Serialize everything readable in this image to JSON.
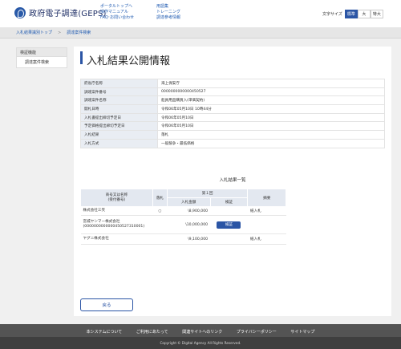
{
  "header": {
    "logo_text": "政府電子調達(GEPS)",
    "links_col1": [
      "ポータルトップへ",
      "操作マニュアル",
      "FAQ･お問い合わせ"
    ],
    "links_col2": [
      "用語集",
      "トレーニング",
      "調達参考情報"
    ],
    "font_size_label": "文字サイズ",
    "font_sizes": [
      "標準",
      "大",
      "特大"
    ],
    "font_size_selected": "標準"
  },
  "breadcrumb": {
    "items": [
      "入札結果識別トップ",
      "調達案件検索"
    ]
  },
  "sidebar": {
    "heading": "検証機能",
    "items": [
      "調達案件検索"
    ]
  },
  "main": {
    "title": "入札結果公開情報",
    "info_rows": [
      {
        "label": "府省庁名称",
        "value": "海上保安庁"
      },
      {
        "label": "調達案件番号",
        "value": "0000000000000450527"
      },
      {
        "label": "調達案件名称",
        "value": "船員用品購買入(単価契約)"
      },
      {
        "label": "開札日時",
        "value": "令和06年05月10日 10時44分"
      },
      {
        "label": "入札書提出締切予定日",
        "value": "令和06年05月10日"
      },
      {
        "label": "予定価格提出締切予定日",
        "value": "令和06年05月10日"
      },
      {
        "label": "入札結果",
        "value": "落札"
      },
      {
        "label": "入札方式",
        "value": "一般競争・最低価格"
      }
    ],
    "results_title": "入札結果一覧",
    "results_headers": {
      "company": "商号又は名称\n(受付番号)",
      "awarded": "落札",
      "round": "第１回",
      "amount": "入札金額",
      "verify": "検証",
      "remarks": "摘要"
    },
    "results_rows": [
      {
        "company": "株式会社三笑",
        "awarded": "○",
        "amount": "\\8,900,000",
        "verify": "",
        "remarks": "紙入札"
      },
      {
        "company": "宮城ヤンマー株式会社\n(0000000000000450527310001)",
        "awarded": "",
        "amount": "\\10,000,000",
        "verify": "検証",
        "remarks": ""
      },
      {
        "company": "ヤグニ株式会社",
        "awarded": "",
        "amount": "\\9,100,000",
        "verify": "",
        "remarks": "紙入札"
      }
    ],
    "back_label": "戻る"
  },
  "footer": {
    "links": [
      "本システムについて",
      "ご利用にあたって",
      "関連サイトへのリンク",
      "プライバシーポリシー",
      "サイトマップ"
    ],
    "copyright": "Copyright © Digital Agency All Rights Reserved."
  },
  "colors": {
    "accent": "#2b55a5",
    "link": "#1c58b0",
    "footer_bg": "#545454"
  }
}
